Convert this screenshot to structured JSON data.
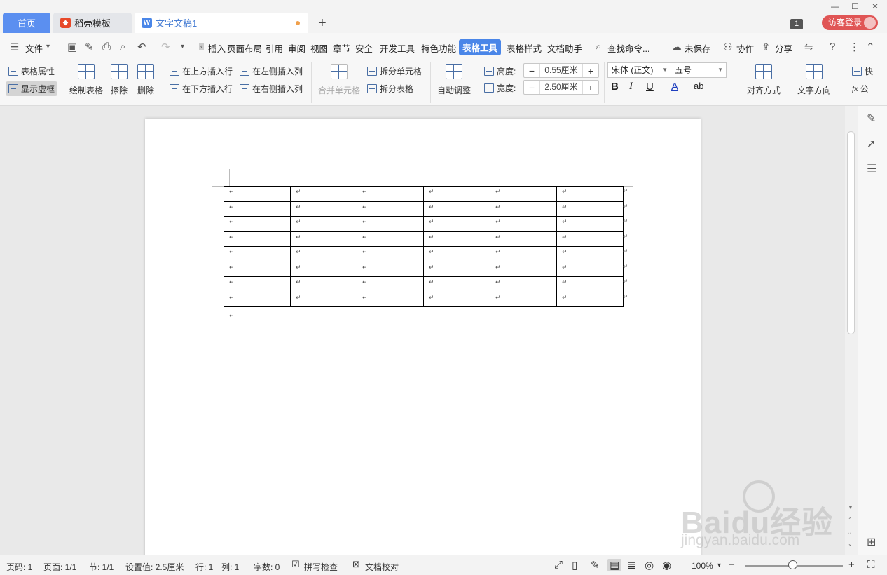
{
  "tabs": {
    "home": "首页",
    "template": "稻壳模板",
    "document": "文字文稿1",
    "new_tab": "+"
  },
  "window": {
    "minimize": "—",
    "maximize": "☐",
    "close": "✕",
    "badge": "1",
    "login": "访客登录"
  },
  "menu": {
    "file": "文件",
    "items": [
      "插入",
      "页面布局",
      "引用",
      "审阅",
      "视图",
      "章节",
      "安全",
      "开发工具",
      "特色功能",
      "表格工具",
      "表格样式",
      "文档助手"
    ],
    "active": "表格工具",
    "search": "查找命令...",
    "unsaved": "未保存",
    "collab": "协作",
    "share": "分享"
  },
  "ribbon": {
    "table_props": "表格属性",
    "show_gridlines": "显示虚框",
    "draw_table": "绘制表格",
    "erase": "擦除",
    "delete": "删除",
    "insert_above": "在上方插入行",
    "insert_below": "在下方插入行",
    "insert_left": "在左侧插入列",
    "insert_right": "在右侧插入列",
    "merge_cells": "合并单元格",
    "split_cells": "拆分单元格",
    "split_table": "拆分表格",
    "auto_fit": "自动调整",
    "height_label": "高度:",
    "height_value": "0.55厘米",
    "width_label": "宽度:",
    "width_value": "2.50厘米",
    "font_name": "宋体 (正文)",
    "font_size": "五号",
    "align": "对齐方式",
    "text_direction": "文字方向",
    "quick": "快",
    "formula": "公"
  },
  "document": {
    "para_mark": "↵",
    "rows": 8,
    "cols": 6
  },
  "watermark": {
    "brand": "Baidu经验",
    "url": "jingyan.baidu.com"
  },
  "status": {
    "page_num": "页码: 1",
    "pages": "页面: 1/1",
    "section": "节: 1/1",
    "setting": "设置值: 2.5厘米",
    "row": "行: 1",
    "col": "列: 1",
    "words": "字数: 0",
    "spell": "拼写检查",
    "proof": "文档校对",
    "zoom": "100%"
  }
}
